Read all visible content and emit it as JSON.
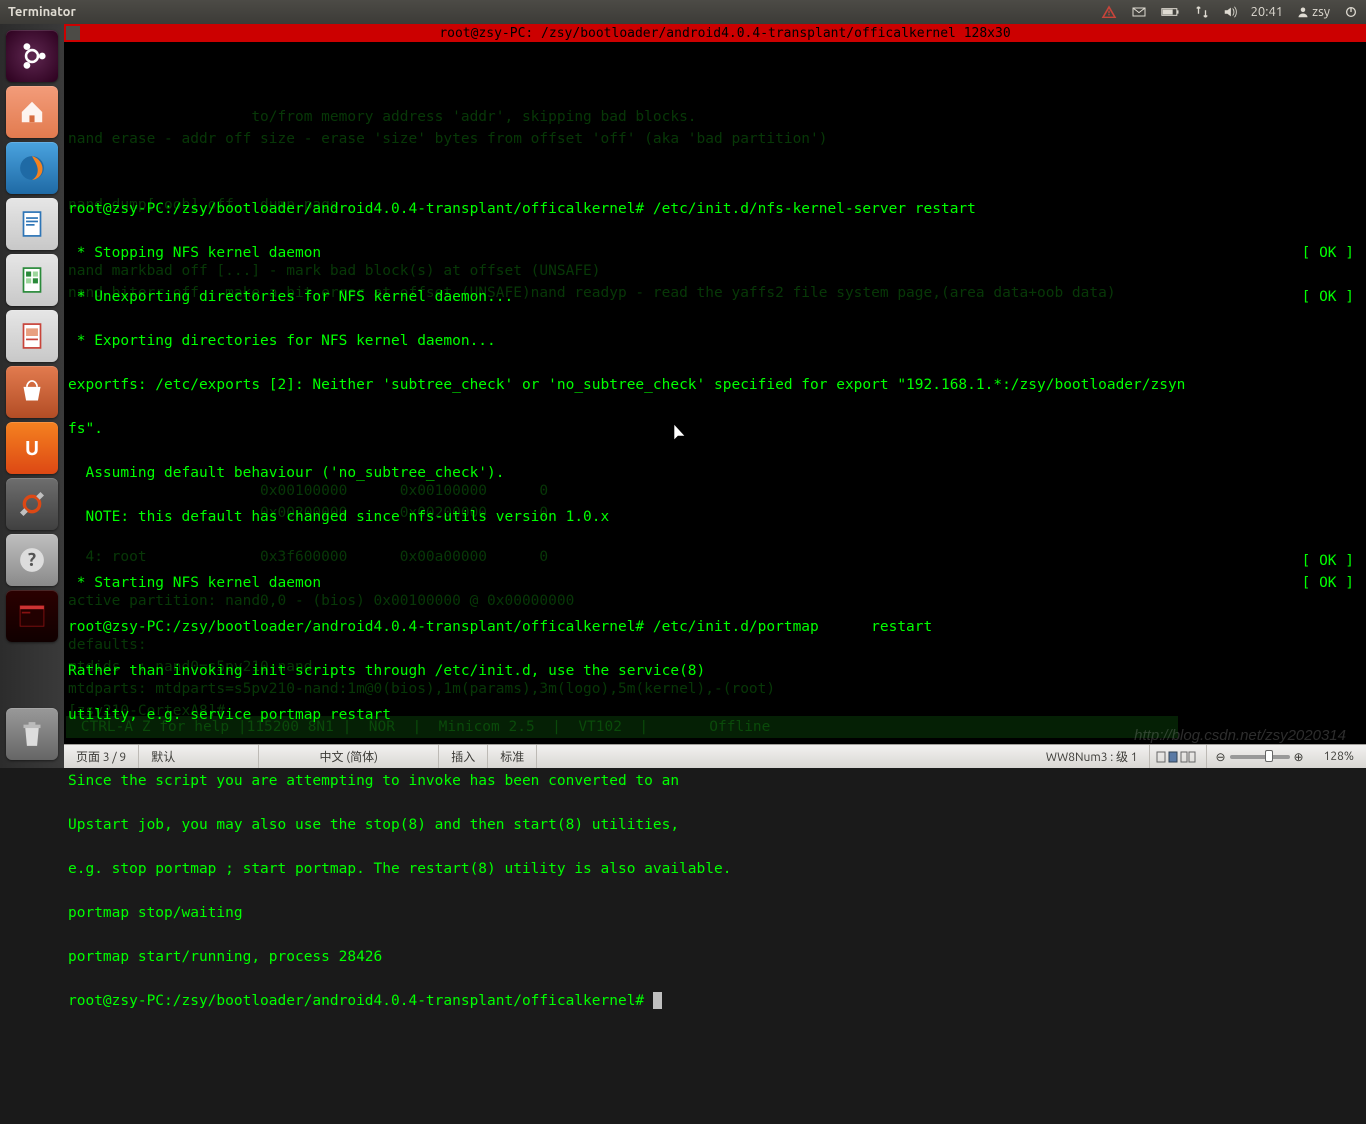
{
  "menubar": {
    "app_title": "Terminator",
    "time": "20:41",
    "user": "zsy"
  },
  "terminal": {
    "title": "root@zsy-PC: /zsy/bootloader/android4.0.4-transplant/officalkernel 128x30",
    "prompt1": "root@zsy-PC:/zsy/bootloader/android4.0.4-transplant/officalkernel# /etc/init.d/nfs-kernel-server restart",
    "l2": " * Stopping NFS kernel daemon",
    "l3": " * Unexporting directories for NFS kernel daemon...",
    "l4": " * Exporting directories for NFS kernel daemon...",
    "l5": "exportfs: /etc/exports [2]: Neither 'subtree_check' or 'no_subtree_check' specified for export \"192.168.1.*:/zsy/bootloader/zsyn",
    "l6": "fs\".",
    "l7": "  Assuming default behaviour ('no_subtree_check').",
    "l8": "  NOTE: this default has changed since nfs-utils version 1.0.x",
    "l9": "",
    "l10": " * Starting NFS kernel daemon",
    "prompt2": "root@zsy-PC:/zsy/bootloader/android4.0.4-transplant/officalkernel# /etc/init.d/portmap      restart",
    "l12": "Rather than invoking init scripts through /etc/init.d, use the service(8)",
    "l13": "utility, e.g. service portmap restart",
    "l14": "",
    "l15": "Since the script you are attempting to invoke has been converted to an",
    "l16": "Upstart job, you may also use the stop(8) and then start(8) utilities,",
    "l17": "e.g. stop portmap ; start portmap. The restart(8) utility is also available.",
    "l18": "portmap stop/waiting",
    "l19": "portmap start/running, process 28426",
    "prompt3": "root@zsy-PC:/zsy/bootloader/android4.0.4-transplant/officalkernel# ",
    "ok": "[ OK ]",
    "bg1": "nand markbad off [...] - mark bad block(s) at offset (UNSAFE)",
    "bg2": "nand biterr off - make a bit error at offset (UNSAFE)nand readyp - read the yaffs2 file system page,(area data+oob data)",
    "bg3": "nand dump[.oob] off - dump page",
    "bg4": "                     to/from memory address 'addr', skipping bad blocks.",
    "bg5": "nand erase - addr off size - erase 'size' bytes from offset 'off' (aka 'bad partition')",
    "bg6": "active partition: nand0,0 - (bios) 0x00100000 @ 0x00000000",
    "bg7": "defaults:",
    "bg8": "mtdids  : nand0=s5pv210-nand",
    "bg9": "mtdparts: mtdparts=s5pv210-nand:1m@0(bios),1m(params),3m(logo),5m(kernel),-(root)",
    "bg10": "[zsy210-CortexA8]# ",
    "bg11": "  4: root             0x3f600000      0x00a00000      0",
    "bg12": "                      0x00100000      0x00100000      0",
    "bg13": "                      0x00200000      0x00200000      0",
    "minicom": " CTRL-A Z for help |115200 8N1 |  NOR  |  Minicom 2.5  |  VT102  |       Offline                                              "
  },
  "statusbar": {
    "page": "页面 3 / 9",
    "style": "默认",
    "lang": "中文 (简体)",
    "insert": "插入",
    "std": "标准",
    "ww8": "WW8Num3 : 级 1",
    "zoom": "128%"
  },
  "watermark": "http://blog.csdn.net/zsy2020314"
}
